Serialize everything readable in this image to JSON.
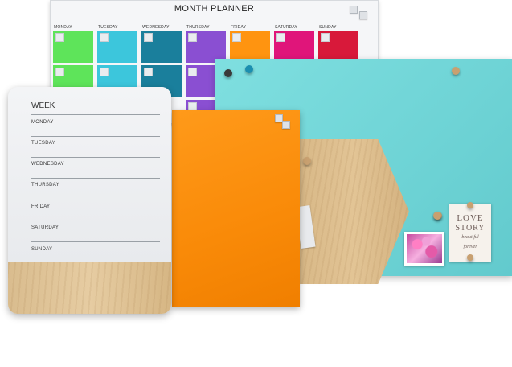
{
  "month_planner": {
    "title": "MONTH PLANNER",
    "days": [
      "MONDAY",
      "TUESDAY",
      "WEDNESDAY",
      "THURSDAY",
      "FRIDAY",
      "SATURDAY",
      "SUNDAY"
    ],
    "day_colors": [
      "#5ee45a",
      "#3cc6dc",
      "#1a7f9c",
      "#8a4fd2",
      "#ff9410",
      "#e0157a",
      "#d8193a"
    ]
  },
  "week_planner": {
    "title": "WEEK",
    "days": [
      "MONDAY",
      "TUESDAY",
      "WEDNESDAY",
      "THURSDAY",
      "FRIDAY",
      "SATURDAY",
      "SUNDAY"
    ]
  },
  "love_card": {
    "lines": [
      "LOVE",
      "STORY",
      "beautiful",
      "forever"
    ]
  },
  "colors": {
    "teal_board": "#6fd4d6",
    "orange_board": "#f98a08",
    "wood": "#dcbd8c"
  }
}
